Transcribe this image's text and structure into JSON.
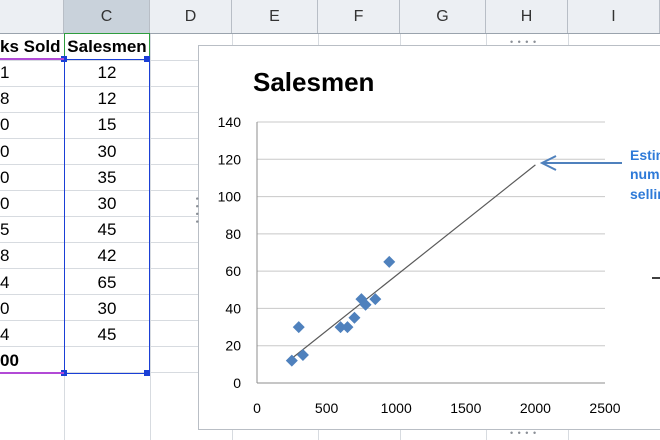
{
  "columns": [
    "",
    "C",
    "D",
    "E",
    "F",
    "G",
    "H",
    "I"
  ],
  "cells": {
    "b_header": "ks Sold",
    "c_header": "Salesmen",
    "b_values": [
      "1",
      "8",
      "0",
      "0",
      "0",
      "0",
      "5",
      "8",
      "4",
      "0",
      "4",
      "00"
    ],
    "c_values": [
      "12",
      "12",
      "15",
      "30",
      "35",
      "30",
      "45",
      "42",
      "65",
      "30",
      "45",
      ""
    ]
  },
  "chart": {
    "title": "Salesmen",
    "annotation_lines": [
      "Estim",
      "numb",
      "sellin"
    ]
  },
  "chart_data": {
    "type": "scatter",
    "title": "Salesmen",
    "xlabel": "",
    "ylabel": "",
    "xlim": [
      0,
      2500
    ],
    "ylim": [
      0,
      140
    ],
    "x_ticks": [
      "0",
      "500",
      "1000",
      "1500",
      "2000",
      "2500"
    ],
    "y_ticks": [
      "0",
      "20",
      "40",
      "60",
      "80",
      "100",
      "120",
      "140"
    ],
    "grid": true,
    "color": "#4f81bd",
    "points": [
      {
        "x": 250,
        "y": 12
      },
      {
        "x": 300,
        "y": 30
      },
      {
        "x": 330,
        "y": 15
      },
      {
        "x": 600,
        "y": 30
      },
      {
        "x": 650,
        "y": 30
      },
      {
        "x": 700,
        "y": 35
      },
      {
        "x": 750,
        "y": 45
      },
      {
        "x": 780,
        "y": 42
      },
      {
        "x": 850,
        "y": 45
      },
      {
        "x": 950,
        "y": 65
      }
    ],
    "trendline": [
      {
        "x": 230,
        "y": 12
      },
      {
        "x": 2000,
        "y": 117
      }
    ]
  }
}
